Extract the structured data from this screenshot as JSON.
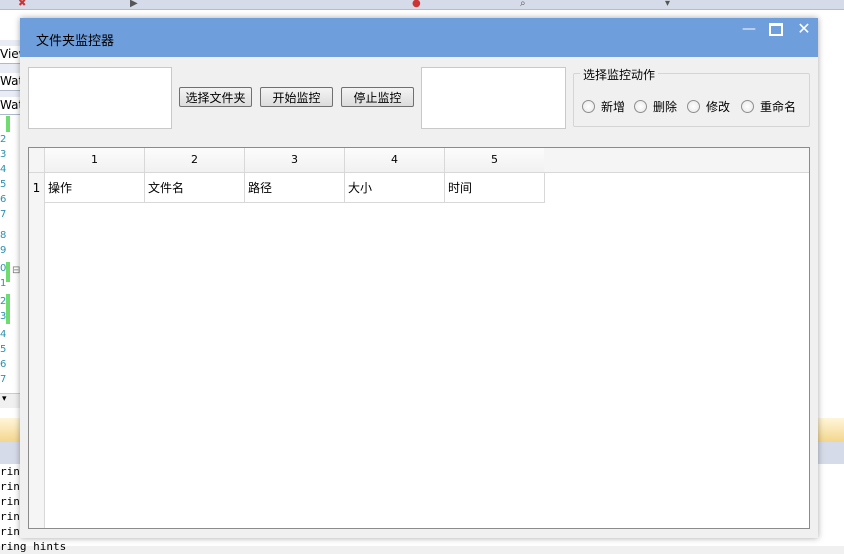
{
  "ide": {
    "tabs": [
      "View",
      "Watc",
      "Watc"
    ],
    "line_numbers": [
      "2",
      "3",
      "4",
      "5",
      "6",
      "7",
      "8",
      "9",
      "0",
      "1",
      "2",
      "3",
      "4",
      "5",
      "6",
      "7"
    ],
    "output_lines": [
      "ring",
      "ring",
      "ring",
      "ring",
      "ring",
      "ring hints"
    ]
  },
  "window": {
    "title": "文件夹监控器",
    "caption": {
      "minimize": "—",
      "close": "✕"
    }
  },
  "toolbar": {
    "left_textbox_value": "",
    "right_textbox_value": "",
    "select_folder_label": "选择文件夹",
    "start_monitor_label": "开始监控",
    "stop_monitor_label": "停止监控"
  },
  "actions": {
    "group_title": "选择监控动作",
    "options": [
      {
        "label": "新增",
        "checked": false
      },
      {
        "label": "删除",
        "checked": false
      },
      {
        "label": "修改",
        "checked": false
      },
      {
        "label": "重命名",
        "checked": false
      }
    ]
  },
  "grid": {
    "column_headers": [
      "1",
      "2",
      "3",
      "4",
      "5"
    ],
    "rows": [
      {
        "header": "1",
        "cells": [
          "操作",
          "文件名",
          "路径",
          "大小",
          "时间"
        ]
      }
    ]
  }
}
